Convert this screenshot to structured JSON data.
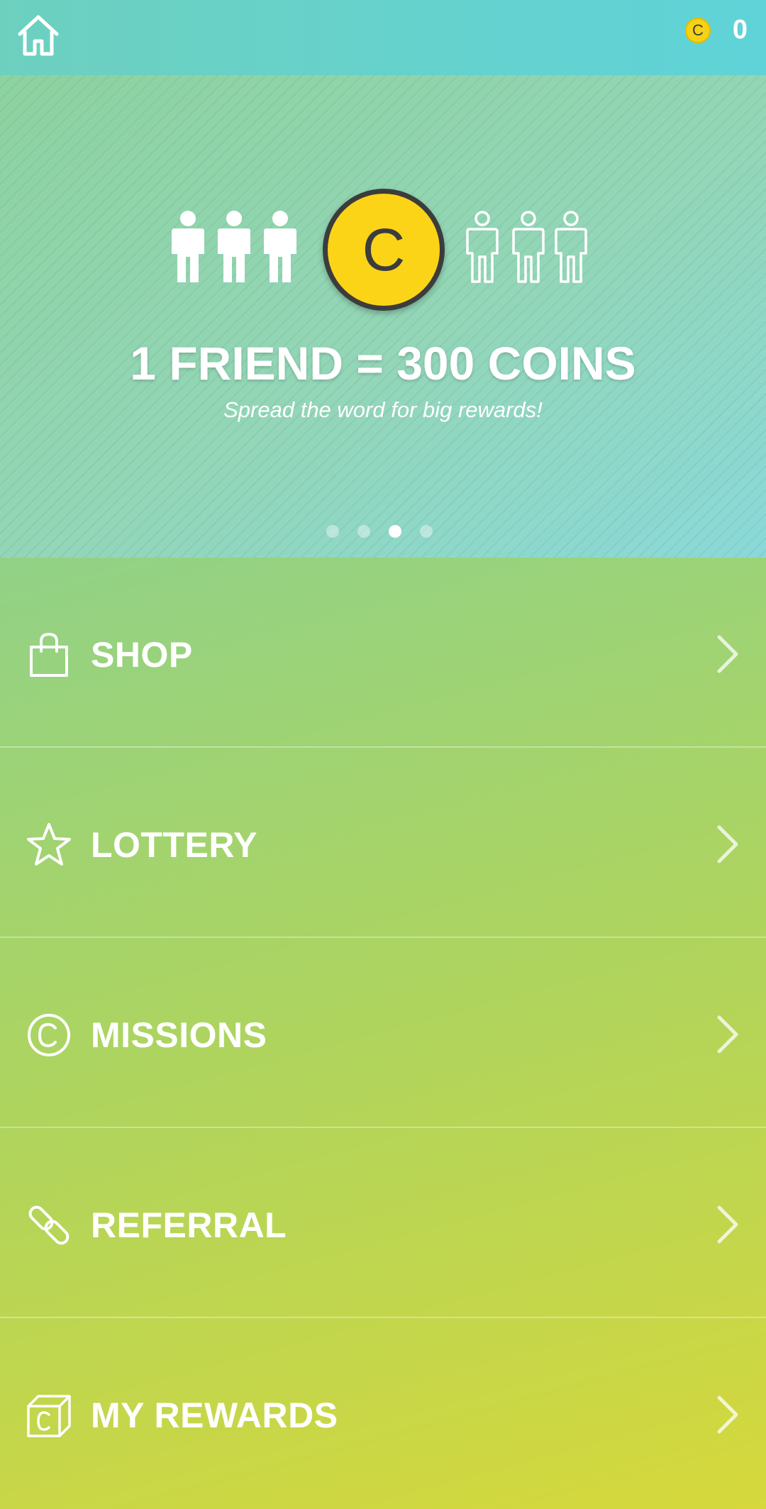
{
  "header": {
    "coin_symbol": "C",
    "coin_count": "0"
  },
  "banner": {
    "coin_symbol": "C",
    "title": "1 FRIEND = 300 COINS",
    "subtitle": "Spread the word for big rewards!",
    "pager": {
      "total": 4,
      "active_index": 2
    },
    "people": {
      "filled": 3,
      "outlined": 3
    }
  },
  "menu": {
    "items": [
      {
        "label": "SHOP",
        "icon": "shopping-bag-icon"
      },
      {
        "label": "LOTTERY",
        "icon": "star-icon"
      },
      {
        "label": "MISSIONS",
        "icon": "coin-outline-icon"
      },
      {
        "label": "REFERRAL",
        "icon": "link-icon"
      },
      {
        "label": "MY REWARDS",
        "icon": "reward-box-icon"
      }
    ]
  },
  "colors": {
    "coin": "#fbd418",
    "coin_outline": "#3c3c3c",
    "header": "#5fd3d8",
    "gradient_top": "#6fcfae",
    "gradient_bottom": "#d6d83b"
  }
}
